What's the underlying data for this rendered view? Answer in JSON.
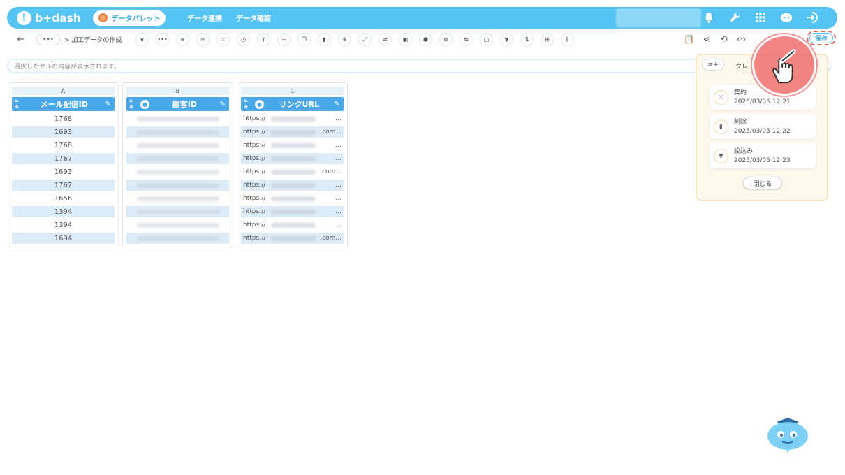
{
  "header": {
    "logo_text": "b+dash",
    "palette_label": "データパレット",
    "nav": [
      "データ連携",
      "データ確認"
    ]
  },
  "toolbar": {
    "back": "←",
    "more": "•••",
    "breadcrumb": "> 加工データの作成",
    "save_label": "保存"
  },
  "cellbar": {
    "placeholder": "選択したセルの内容が表示されます。"
  },
  "columns": [
    {
      "letter": "A",
      "type_label": "a.あ",
      "title": "メール配信ID",
      "values": [
        "1768",
        "1693",
        "1768",
        "1767",
        "1693",
        "1767",
        "1656",
        "1394",
        "1394",
        "1694"
      ]
    },
    {
      "letter": "B",
      "type_label": "a.あ",
      "title": "顧客ID"
    },
    {
      "letter": "C",
      "type_label": "a.あ",
      "title": "リンクURL",
      "url_prefix": "https://",
      "url_suffixes": [
        "...",
        ".com...",
        "...",
        "...",
        ".com...",
        "...",
        "...",
        "...",
        "...",
        ".com..."
      ]
    }
  ],
  "history": {
    "title": "クレ",
    "items": [
      {
        "name": "集約",
        "time": "2025/03/05 12:21",
        "icon": "collapse-icon"
      },
      {
        "name": "削除",
        "time": "2025/03/05 12:22",
        "icon": "trash-icon"
      },
      {
        "name": "絞込み",
        "time": "2025/03/05 12:23",
        "icon": "filter-icon"
      }
    ],
    "close_label": "閉じる"
  },
  "colors": {
    "header_bg": "#56c4f2",
    "column_header": "#4aa9e8",
    "row_alt": "#dcebf8",
    "history_bg": "#fdf8ec",
    "pointer": "#f06e6e"
  }
}
